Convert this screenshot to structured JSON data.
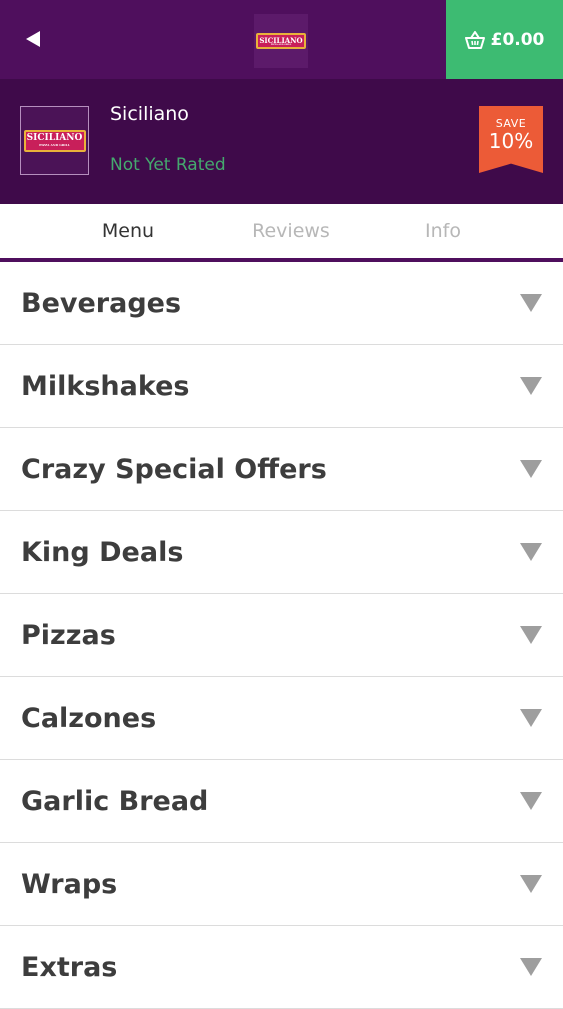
{
  "topbar": {
    "back_icon": "back-triangle-icon",
    "logo_text": "SICILIANO",
    "logo_tagline": "PIZZA AND GRILL",
    "basket_icon": "basket-icon",
    "basket_total": "£0.00",
    "colors": {
      "bar": "#4f0f5d",
      "basket": "#3dbb72"
    }
  },
  "header": {
    "logo_text": "SICILIANO",
    "logo_tagline": "PIZZA AND GRILL",
    "name": "Siciliano",
    "rating": "Not Yet Rated",
    "save_label": "SAVE",
    "save_value": "10%",
    "colors": {
      "background": "#3f0a4a",
      "rating": "#45a96e",
      "badge": "#ec5b37"
    }
  },
  "tabs": [
    {
      "label": "Menu",
      "active": true
    },
    {
      "label": "Reviews",
      "active": false
    },
    {
      "label": "Info",
      "active": false
    }
  ],
  "categories": [
    {
      "label": "Beverages",
      "icon": "chevron-down-icon"
    },
    {
      "label": "Milkshakes",
      "icon": "chevron-down-icon"
    },
    {
      "label": "Crazy Special Offers",
      "icon": "chevron-down-icon"
    },
    {
      "label": "King Deals",
      "icon": "chevron-down-icon"
    },
    {
      "label": "Pizzas",
      "icon": "chevron-down-icon"
    },
    {
      "label": "Calzones",
      "icon": "chevron-down-icon"
    },
    {
      "label": "Garlic Bread",
      "icon": "chevron-down-icon"
    },
    {
      "label": "Wraps",
      "icon": "chevron-down-icon"
    },
    {
      "label": "Extras",
      "icon": "chevron-down-icon"
    }
  ]
}
